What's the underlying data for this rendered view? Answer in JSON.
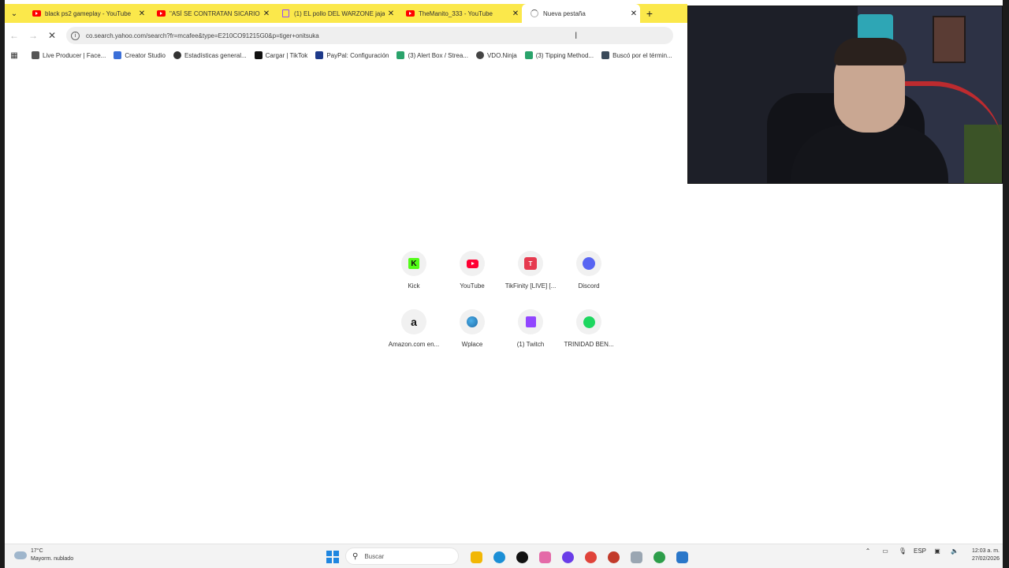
{
  "browser": {
    "tabs": [
      {
        "title": "black ps2 gameplay - YouTube",
        "icon": "youtube-icon",
        "active": false
      },
      {
        "title": "\"ASÍ SE CONTRATAN SICARIOS",
        "icon": "youtube-icon",
        "active": false
      },
      {
        "title": "(1) EL pollo DEL WARZONE jaja",
        "icon": "twitch-icon",
        "active": false
      },
      {
        "title": "TheManito_333 - YouTube",
        "icon": "youtube-icon",
        "active": false
      },
      {
        "title": "Nueva pestaña",
        "icon": "loading-icon",
        "active": true
      }
    ],
    "close_glyph": "✕",
    "new_tab_glyph": "+",
    "url": "co.search.yahoo.com/search?fr=mcafee&type=E210CO91215G0&p=tiger+onitsuka",
    "bookmarks": [
      {
        "label": "Live Producer | Face...",
        "color": "#555555"
      },
      {
        "label": "Creator Studio",
        "color": "#3b6fd8"
      },
      {
        "label": "Estadísticas general...",
        "color": "#333333"
      },
      {
        "label": "Cargar | TikTok",
        "color": "#111111"
      },
      {
        "label": "PayPal: Configuración",
        "color": "#1e3a8a"
      },
      {
        "label": "(3) Alert Box / Strea...",
        "color": "#2aa36b"
      },
      {
        "label": "VDO.Ninja",
        "color": "#444444"
      },
      {
        "label": "(3) Tipping Method...",
        "color": "#2aa36b"
      },
      {
        "label": "Buscó por el términ...",
        "color": "#3a4a5a"
      }
    ]
  },
  "new_tab_page": {
    "shortcuts": [
      {
        "label": "Kick",
        "icon": "kick-icon"
      },
      {
        "label": "YouTube",
        "icon": "youtube-icon"
      },
      {
        "label": "TikFinity [LIVE] [...",
        "icon": "tikfinity-icon"
      },
      {
        "label": "Discord",
        "icon": "discord-icon"
      },
      {
        "label": "Amazon.com en...",
        "icon": "amazon-icon"
      },
      {
        "label": "Wplace",
        "icon": "globe-icon"
      },
      {
        "label": "(1) Twitch",
        "icon": "twitch-icon"
      },
      {
        "label": "TRINIDAD BEN...",
        "icon": "spotify-icon"
      }
    ]
  },
  "taskbar": {
    "weather_temp": "17°C",
    "weather_desc": "Mayorm. nublado",
    "search_placeholder": "Buscar",
    "apps": [
      {
        "name": "file-explorer-icon",
        "color": "#f2b705"
      },
      {
        "name": "edge-icon",
        "color": "#1b8fd6"
      },
      {
        "name": "tiktok-icon",
        "color": "#111111"
      },
      {
        "name": "copilot-icon",
        "color": "#e46aa8"
      },
      {
        "name": "obs-icon",
        "color": "#6a3de8"
      },
      {
        "name": "chrome-icon",
        "color": "#e0433a"
      },
      {
        "name": "chrome-dev-icon",
        "color": "#c23a2a"
      },
      {
        "name": "vscode-icon",
        "color": "#9aa6b2"
      },
      {
        "name": "chrome-active-icon",
        "color": "#2d9e4a"
      },
      {
        "name": "blue-app-icon",
        "color": "#2a77c9"
      }
    ],
    "language": "ESP",
    "time": "12:03 a. m.",
    "date": "27/02/2026"
  }
}
